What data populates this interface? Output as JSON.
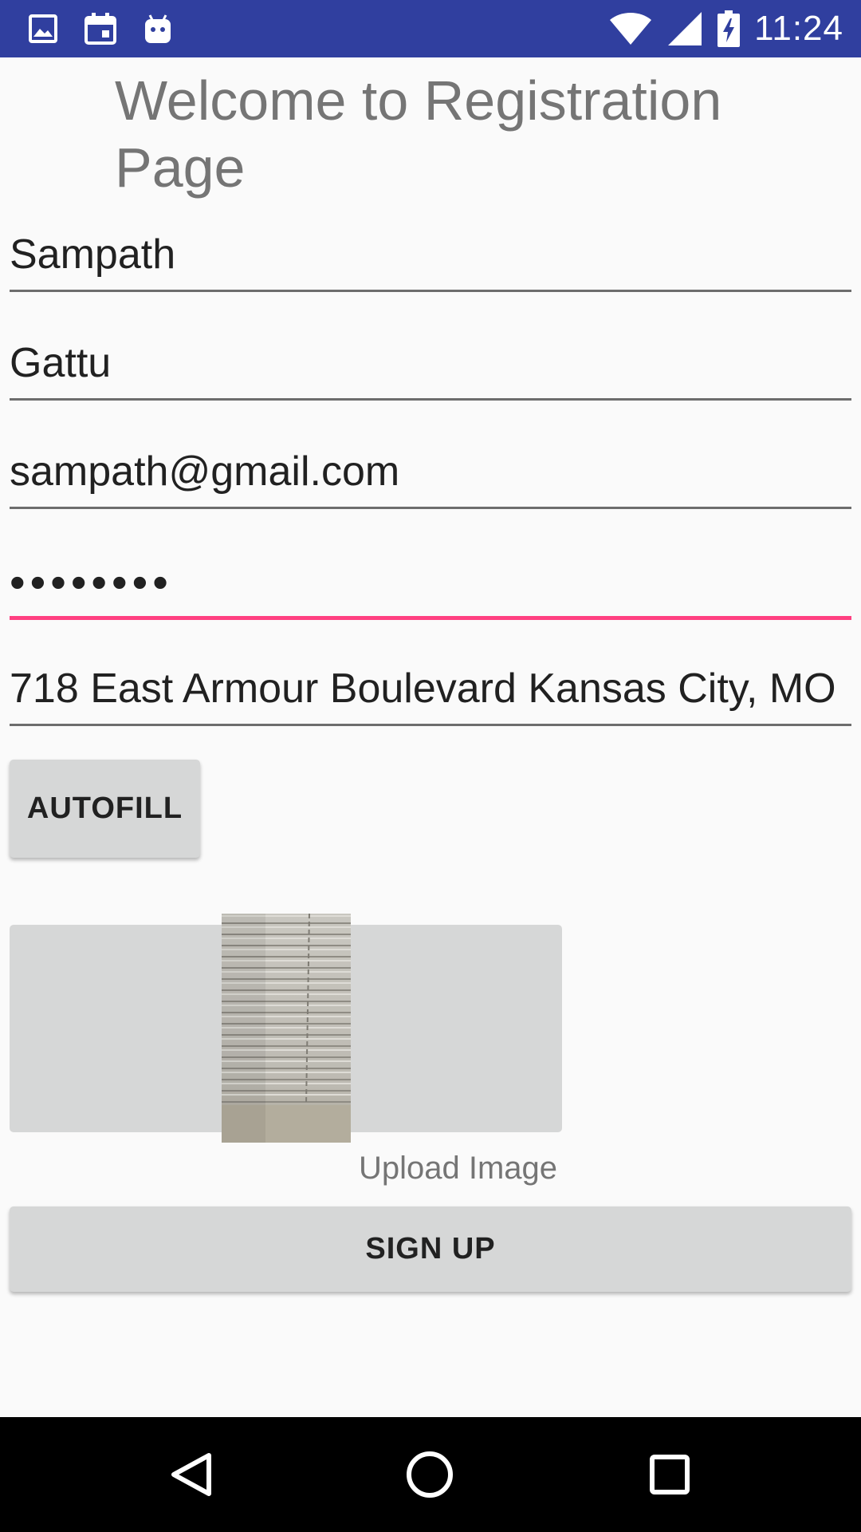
{
  "status_bar": {
    "time": "11:24",
    "left_icons": [
      "image-icon",
      "calendar-icon",
      "android-icon"
    ],
    "right_icons": [
      "wifi-icon",
      "cell-signal-icon",
      "battery-charging-icon"
    ],
    "background": "#303f9f"
  },
  "page": {
    "title": "Welcome to Registration Page"
  },
  "form": {
    "first_name": "Sampath",
    "last_name": "Gattu",
    "email": "sampath@gmail.com",
    "password_masked": "••••••••",
    "address": "718 East Armour Boulevard Kansas City, MO",
    "focus_color": "#ff4081"
  },
  "buttons": {
    "autofill": "AUTOFILL",
    "sign_up": "SIGN UP"
  },
  "image_upload": {
    "label": "Upload Image"
  },
  "nav_bar": {
    "icons": [
      "back-icon",
      "home-icon",
      "recents-icon"
    ]
  }
}
